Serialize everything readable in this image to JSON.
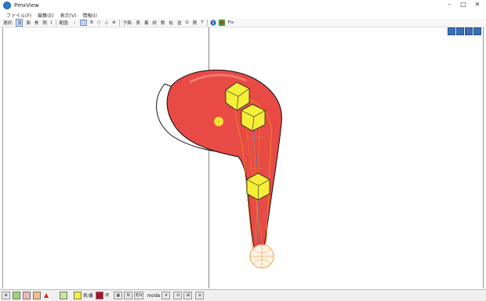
{
  "window": {
    "title": "PmxView"
  },
  "menu": [
    "ファイル(F)",
    "編集(E)",
    "表示(V)",
    "情報(I)"
  ],
  "toolbar": {
    "select_label": "選択:",
    "select_items": [
      "頂",
      "面",
      "骨",
      "剛",
      "J"
    ],
    "range_label": "範囲:",
    "range_items": [
      "・",
      "□",
      "B",
      "○",
      "△",
      "⊕"
    ],
    "subject_label": "子面:",
    "subject_items": [
      "表",
      "裏",
      "絞",
      "数",
      "拡",
      "追",
      "G",
      "剛",
      "T"
    ],
    "fix_label": "Fix"
  },
  "statusbar": {
    "front_label": "表/裏",
    "edge_label": "/E",
    "mode_label": "mode",
    "mode_select_label": "E/V"
  },
  "colors": {
    "model_red": "#e84a45",
    "bone_yellow": "#f5ef3a",
    "rigid_orange": "#e8901a",
    "accent_blue": "#3c6fb5"
  }
}
